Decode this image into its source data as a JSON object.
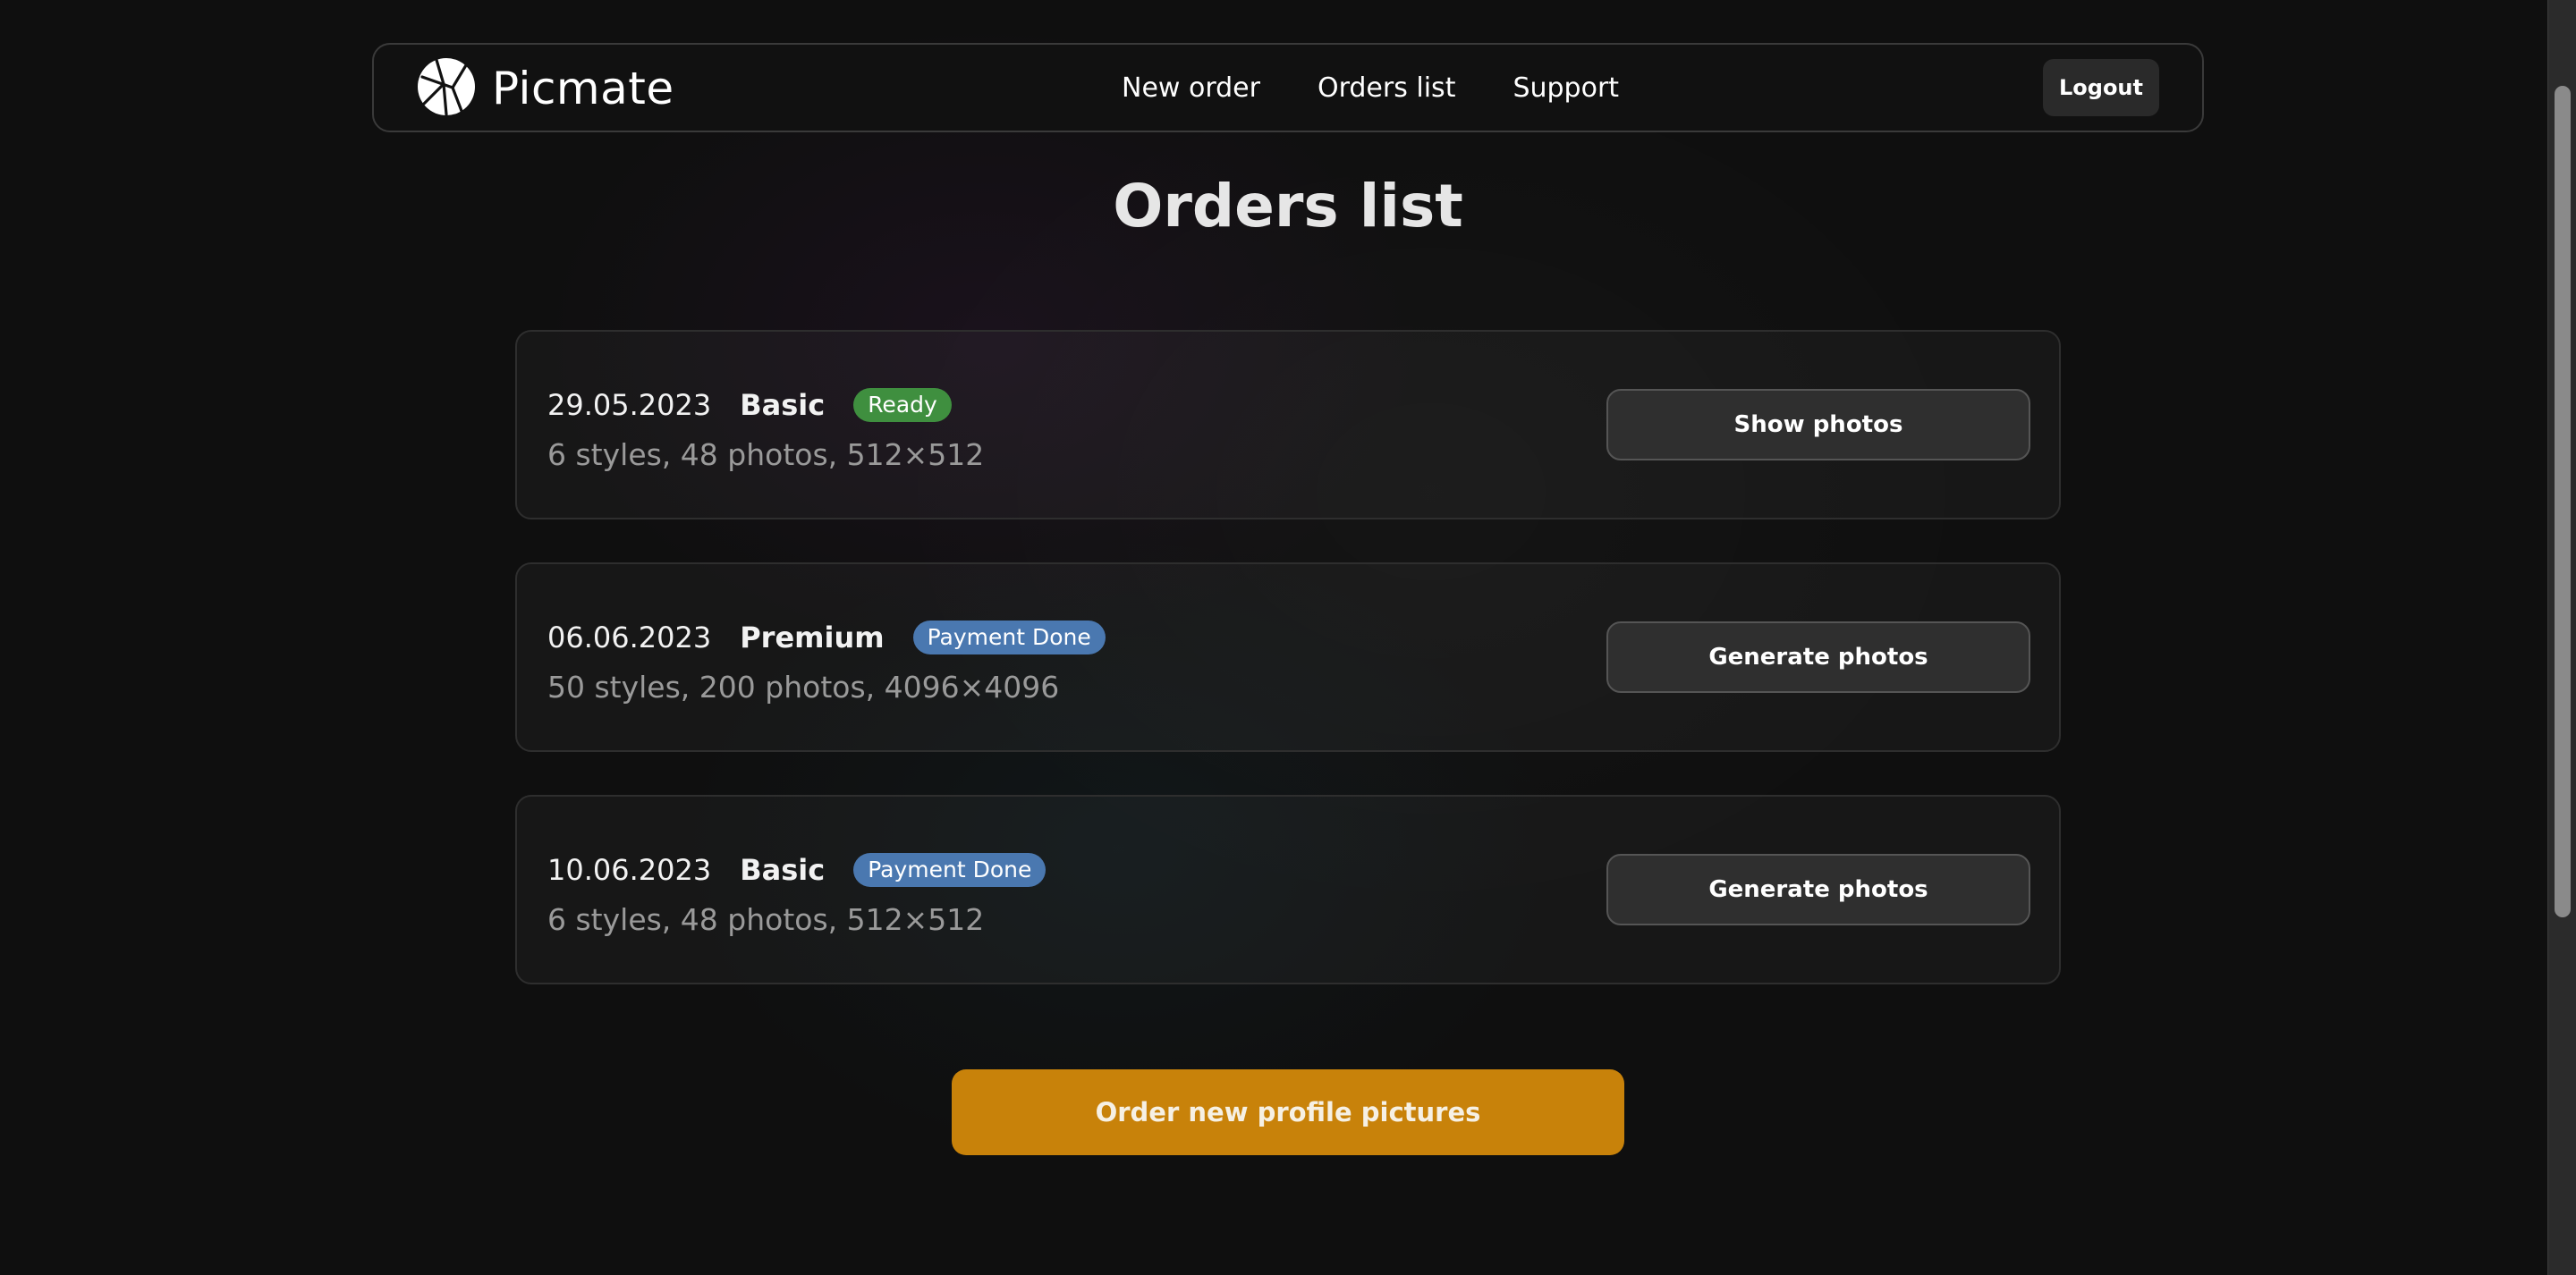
{
  "header": {
    "brand": "Picmate",
    "logo_icon": "aperture-logo-icon",
    "nav": [
      "New order",
      "Orders list",
      "Support"
    ],
    "logout_label": "Logout"
  },
  "page": {
    "title": "Orders list"
  },
  "orders": [
    {
      "date": "29.05.2023",
      "plan": "Basic",
      "status": "Ready",
      "status_color": "#3f8f3f",
      "details": "6 styles, 48 photos, 512×512",
      "action": "Show photos"
    },
    {
      "date": "06.06.2023",
      "plan": "Premium",
      "status": "Payment Done",
      "status_color": "#4a78b0",
      "details": "50 styles, 200 photos, 4096×4096",
      "action": "Generate photos"
    },
    {
      "date": "10.06.2023",
      "plan": "Basic",
      "status": "Payment Done",
      "status_color": "#4a78b0",
      "details": "6 styles, 48 photos, 512×512",
      "action": "Generate photos"
    }
  ],
  "cta": {
    "label": "Order new profile pictures",
    "color": "#c8820a"
  }
}
